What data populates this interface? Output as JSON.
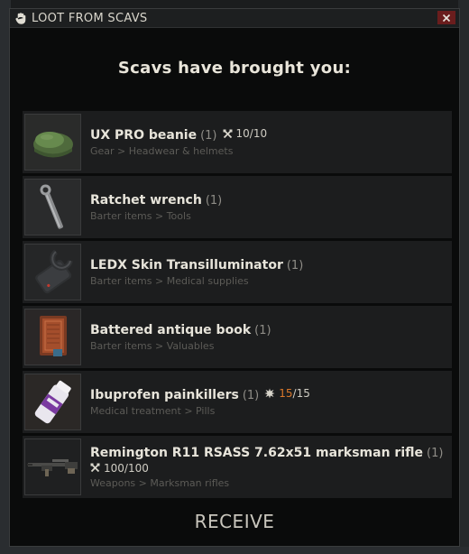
{
  "window": {
    "title": "LOOT FROM SCAVS"
  },
  "heading": "Scavs have brought you:",
  "items": [
    {
      "name": "UX PRO beanie",
      "qty": "(1)",
      "stat": {
        "icon": "durability-icon",
        "current": "10",
        "max": "/10",
        "color": "#cfccc3"
      },
      "category": "Gear > Headwear & helmets"
    },
    {
      "name": "Ratchet wrench",
      "qty": "(1)",
      "category": "Barter items > Tools"
    },
    {
      "name": "LEDX Skin Transilluminator",
      "qty": "(1)",
      "category": "Barter items > Medical supplies"
    },
    {
      "name": "Battered antique book",
      "qty": "(1)",
      "category": "Barter items > Valuables"
    },
    {
      "name": "Ibuprofen painkillers",
      "qty": "(1)",
      "stat": {
        "icon": "medical-uses-icon",
        "current": "15",
        "max": "/15",
        "color": "#d9772b"
      },
      "category": "Medical treatment > Pills"
    },
    {
      "name": "Remington R11 RSASS 7.62x51 marksman rifle",
      "qty": "(1)",
      "stat": {
        "icon": "durability-icon",
        "current": "100",
        "max": "/100",
        "color": "#cfccc3"
      },
      "category": "Weapons > Marksman rifles"
    }
  ],
  "receive_label": "RECEIVE",
  "colors": {
    "window_bg": "#0a0b0b",
    "row_bg": "#1c1d1e",
    "close_bg": "#6a1d1d",
    "accent_orange": "#d9772b"
  }
}
